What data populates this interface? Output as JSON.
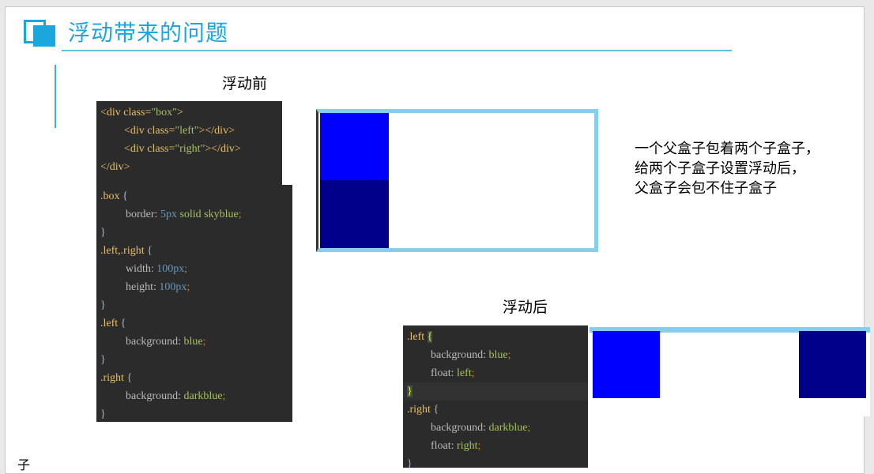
{
  "slide": {
    "title": "浮动带来的问题",
    "before_label": "浮动前",
    "after_label": "浮动后",
    "description": [
      "一个父盒子包着两个子盒子，",
      "给两个子盒子设置浮动后，",
      "父盒子会包不住子盒子"
    ],
    "stray_char": "子"
  },
  "html_code": {
    "line1_tag_open": "<div class=",
    "line1_value": "\"box\"",
    "line1_tag_close": ">",
    "line2_tag_open": "<div class=",
    "line2_value": "\"left\"",
    "line2_tag_close": "></div>",
    "line3_tag_open": "<div class=",
    "line3_value": "\"right\"",
    "line3_tag_close": "></div>",
    "line4": "</div>"
  },
  "css_code": {
    "box_selector": ".box",
    "open_brace": "{",
    "close_brace": "}",
    "border_prop": "border:",
    "border_num": "5px",
    "border_val": "solid skyblue",
    "semicolon": ";",
    "leftright_selector": ".left,.right",
    "width_prop": "width:",
    "width_val": "100px",
    "height_prop": "height:",
    "height_val": "100px",
    "left_selector": ".left",
    "bg_prop": "background:",
    "bg_blue": "blue",
    "right_selector": ".right",
    "bg_darkblue": "darkblue"
  },
  "css_code_after": {
    "left_selector": ".left",
    "open_brace": "{",
    "close_brace": "}",
    "bg_prop": "background:",
    "bg_blue": "blue",
    "float_prop": "float:",
    "float_left": "left",
    "semicolon": ";",
    "right_selector": ".right",
    "bg_darkblue": "darkblue",
    "float_right": "right"
  },
  "colors": {
    "accent": "#1ca6de",
    "skyblue": "#87ceeb",
    "blue": "#0000ff",
    "darkblue": "#00008b",
    "code_bg": "#2b2b2b"
  }
}
